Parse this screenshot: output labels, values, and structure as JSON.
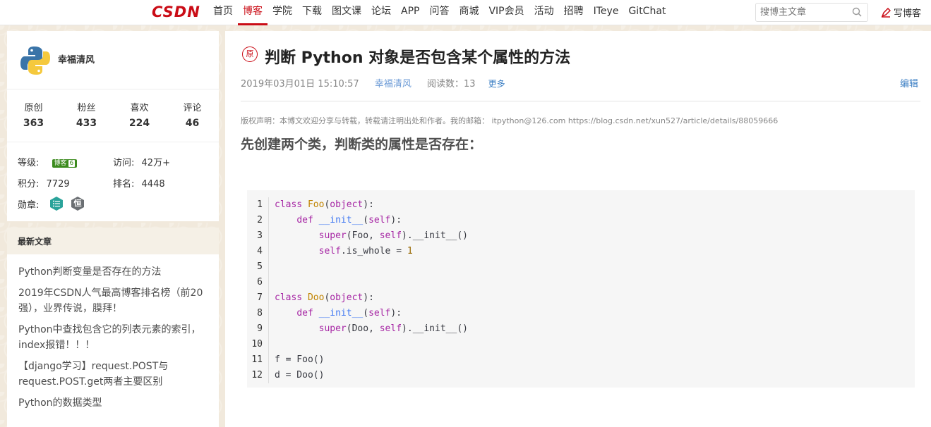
{
  "nav": {
    "logo": "CSDN",
    "items": [
      "首页",
      "博客",
      "学院",
      "下载",
      "图文课",
      "论坛",
      "APP",
      "问答",
      "商城",
      "VIP会员",
      "活动",
      "招聘",
      "ITeye",
      "GitChat"
    ],
    "active_index": 1,
    "search_placeholder": "搜博主文章",
    "write_label": "写博客"
  },
  "profile": {
    "username": "幸福清风",
    "stats": [
      {
        "label": "原创",
        "value": "363"
      },
      {
        "label": "粉丝",
        "value": "433"
      },
      {
        "label": "喜欢",
        "value": "224"
      },
      {
        "label": "评论",
        "value": "46"
      }
    ],
    "level_label": "等级:",
    "level_badge": "博客",
    "level_num": "6",
    "visits_label": "访问:",
    "visits_value": "42万+",
    "points_label": "积分:",
    "points_value": "7729",
    "rank_label": "排名:",
    "rank_value": "4448",
    "medals_label": "勋章:",
    "medal_2_glyph": "恒"
  },
  "latest": {
    "title": "最新文章",
    "items": [
      "Python判断变量是否存在的方法",
      "2019年CSDN人气最高博客排名榜（前20强），业界传说，膜拜！",
      "Python中查找包含它的列表元素的索引，index报错！！！",
      "【django学习】request.POST与request.POST.get两者主要区别",
      "Python的数据类型"
    ]
  },
  "article": {
    "badge": "原",
    "title": "判断 Python 对象是否包含某个属性的方法",
    "date": "2019年03月01日 15:10:57",
    "author": "幸福清风",
    "reads": "阅读数：13",
    "more": "更多",
    "edit": "编辑",
    "copyright": "版权声明：本博文欢迎分享与转载，转载请注明出处和作者。我的邮箱： itpython@126.com https://blog.csdn.net/xun527/article/details/88059666",
    "heading": "先创建两个类，判断类的属性是否存在：",
    "code_line_numbers": [
      "1",
      "2",
      "3",
      "4",
      "5",
      "6",
      "7",
      "8",
      "9",
      "10",
      "11",
      "12"
    ],
    "code": {
      "l1": [
        "class",
        "Foo",
        "(",
        "object",
        "):"
      ],
      "l2": [
        "def",
        "__init__",
        "(",
        "self",
        "):"
      ],
      "l3": [
        "super",
        "(Foo, ",
        "self",
        ").__init__()"
      ],
      "l4": [
        "self",
        ".is_whole = ",
        "1"
      ],
      "l7": [
        "class",
        "Doo",
        "(",
        "object",
        "):"
      ],
      "l8": [
        "def",
        "__init__",
        "(",
        "self",
        "):"
      ],
      "l9": [
        "super",
        "(Doo, ",
        "self",
        ").__init__()"
      ],
      "l11": "f = Foo()",
      "l12": "d = Doo()"
    }
  },
  "colors": {
    "brand": "#ca0c16",
    "link": "#3c7fc4",
    "author": "#6b9ad6"
  }
}
